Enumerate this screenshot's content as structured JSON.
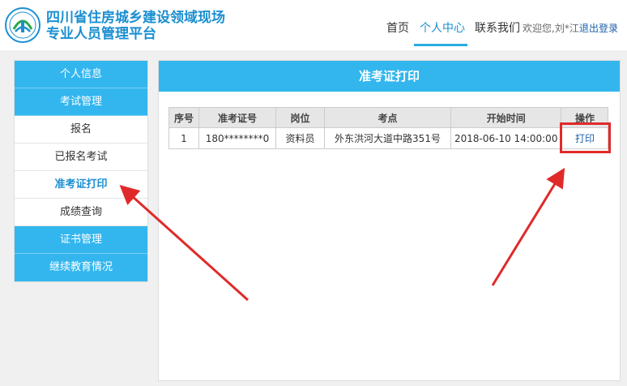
{
  "brand": {
    "line1": "四川省住房城乡建设领域现场",
    "line2": "专业人员管理平台"
  },
  "nav": {
    "home": "首页",
    "personal": "个人中心",
    "contact": "联系我们",
    "welcome": "欢迎您,刘*江",
    "logout": "退出登录"
  },
  "sidebar": {
    "items": [
      {
        "label": "个人信息"
      },
      {
        "label": "考试管理"
      },
      {
        "label": "报名"
      },
      {
        "label": "已报名考试"
      },
      {
        "label": "准考证打印"
      },
      {
        "label": "成绩查询"
      },
      {
        "label": "证书管理"
      },
      {
        "label": "继续教育情况"
      }
    ]
  },
  "panel": {
    "title": "准考证打印",
    "columns": [
      "序号",
      "准考证号",
      "岗位",
      "考点",
      "开始时间",
      "操作"
    ],
    "rows": [
      {
        "index": "1",
        "ticket": "180********0",
        "post": "资料员",
        "site": "外东洪河大道中路351号",
        "start": "2018-06-10 14:00:00",
        "action": "打印"
      }
    ]
  },
  "colors": {
    "accent": "#33b6ee",
    "brand": "#1b8fd1",
    "annotation": "#e02a2a"
  }
}
